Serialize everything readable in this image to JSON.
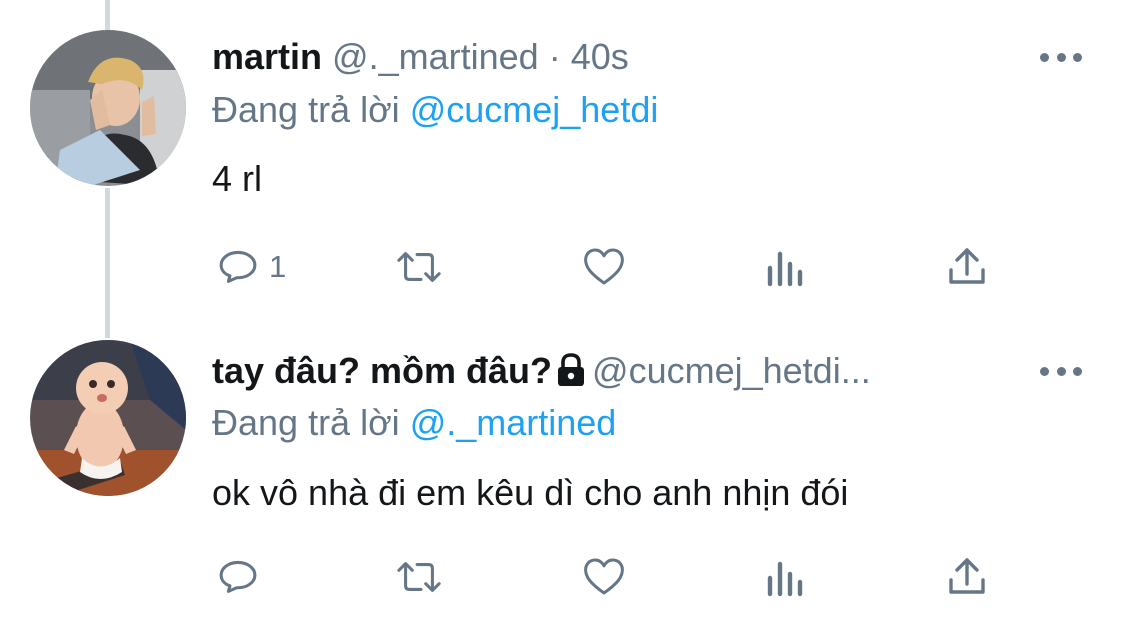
{
  "tweets": [
    {
      "name": "martin",
      "handle": "@._martined",
      "separator": " · ",
      "time": "40s",
      "reply_prefix": "Đang trả lời ",
      "reply_mention": "@cucmej_hetdi",
      "text": "4 rl",
      "reply_count": "1"
    },
    {
      "name": "tay đâu? mồm đâu?",
      "handle": "@cucmej_hetdi...",
      "reply_prefix": "Đang trả lời ",
      "reply_mention": "@._martined",
      "text": "ok vô nhà đi em kêu dì cho anh nhịn đói",
      "reply_count": ""
    }
  ],
  "icons": {
    "reply": "reply-icon",
    "retweet": "retweet-icon",
    "like": "heart-icon",
    "analytics": "analytics-icon",
    "share": "share-icon",
    "more": "more-icon",
    "lock": "lock-icon"
  },
  "colors": {
    "text": "#14171a",
    "secondary": "#657786",
    "link": "#1da1f2",
    "thread_line": "#cfd9de"
  }
}
